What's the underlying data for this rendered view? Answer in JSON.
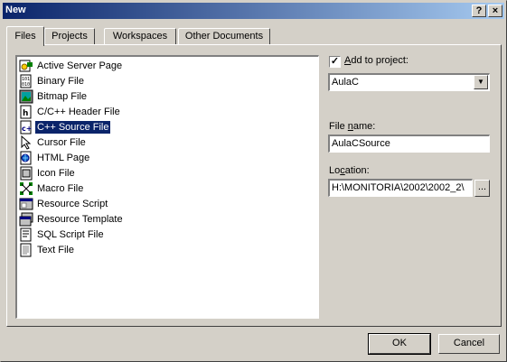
{
  "window": {
    "title": "New",
    "help_glyph": "?",
    "close_glyph": "×"
  },
  "tabs": [
    {
      "label": "Files"
    },
    {
      "label": "Projects"
    },
    {
      "label": "Workspaces"
    },
    {
      "label": "Other Documents"
    }
  ],
  "file_types": [
    {
      "label": "Active Server Page",
      "icon": "asp-icon"
    },
    {
      "label": "Binary File",
      "icon": "binary-file-icon"
    },
    {
      "label": "Bitmap File",
      "icon": "bitmap-icon"
    },
    {
      "label": "C/C++ Header File",
      "icon": "header-file-icon"
    },
    {
      "label": "C++ Source File",
      "icon": "cpp-source-icon",
      "selected": true
    },
    {
      "label": "Cursor File",
      "icon": "cursor-icon"
    },
    {
      "label": "HTML Page",
      "icon": "html-page-icon"
    },
    {
      "label": "Icon File",
      "icon": "icon-file-icon"
    },
    {
      "label": "Macro File",
      "icon": "macro-icon"
    },
    {
      "label": "Resource Script",
      "icon": "resource-script-icon"
    },
    {
      "label": "Resource Template",
      "icon": "resource-template-icon"
    },
    {
      "label": "SQL Script File",
      "icon": "sql-script-icon"
    },
    {
      "label": "Text File",
      "icon": "text-file-icon"
    }
  ],
  "add_to_project": {
    "label_pre": "",
    "label_ul": "A",
    "label_post": "dd to project:",
    "checked": true,
    "check_glyph": "✓"
  },
  "project_select": {
    "value": "AulaC",
    "arrow": "▼"
  },
  "file_name": {
    "label_pre": "File ",
    "label_ul": "n",
    "label_post": "ame:",
    "value": "AulaCSource"
  },
  "location": {
    "label_pre": "Lo",
    "label_ul": "c",
    "label_post": "ation:",
    "value": "H:\\MONITORIA\\2002\\2002_2\\",
    "browse_label": "..."
  },
  "buttons": {
    "ok": "OK",
    "cancel": "Cancel"
  },
  "colors": {
    "selection": "#0a246a",
    "face": "#d4d0c8",
    "title_start": "#0a246a",
    "title_end": "#a6caf0"
  }
}
